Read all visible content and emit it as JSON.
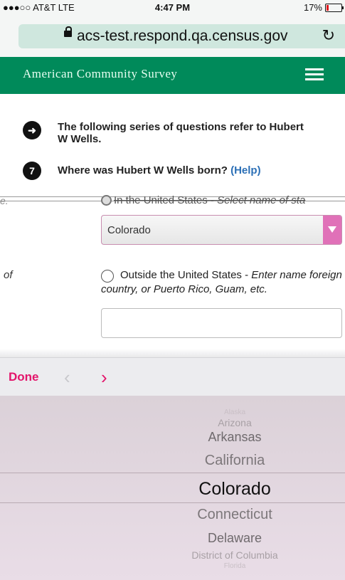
{
  "status_bar": {
    "carrier": "●●●○○ AT&T  LTE",
    "time": "4:47 PM",
    "battery": "17%",
    "battery_level": 0.17
  },
  "address_bar": {
    "url": "acs-test.respond.qa.census.gov"
  },
  "header": {
    "title": "American Community Survey"
  },
  "intro": {
    "text": "The following series of questions refer to Hubert W Wells."
  },
  "question": {
    "number": "7",
    "text": "Where was Hubert W Wells born?",
    "help": "(Help)"
  },
  "glitch_fragment": "e.",
  "option_us": {
    "label": "In the United States - ",
    "hint": "Select name of sta"
  },
  "state_select": {
    "value": "Colorado"
  },
  "left_fragment": "of",
  "option_outside": {
    "label": "Outside the United States - ",
    "hint": "Enter name foreign country, or Puerto Rico, Guam, etc."
  },
  "toolbar": {
    "done": "Done",
    "prev": "‹",
    "next": "›"
  },
  "picker": {
    "items": [
      "Alaska",
      "Arizona",
      "Arkansas",
      "California",
      "Colorado",
      "Connecticut",
      "Delaware",
      "District of Columbia",
      "Florida"
    ],
    "selected": "Colorado"
  },
  "colors": {
    "header_green": "#008a5a",
    "accent_pink": "#e3156b",
    "help_blue": "#2b6fb6"
  }
}
